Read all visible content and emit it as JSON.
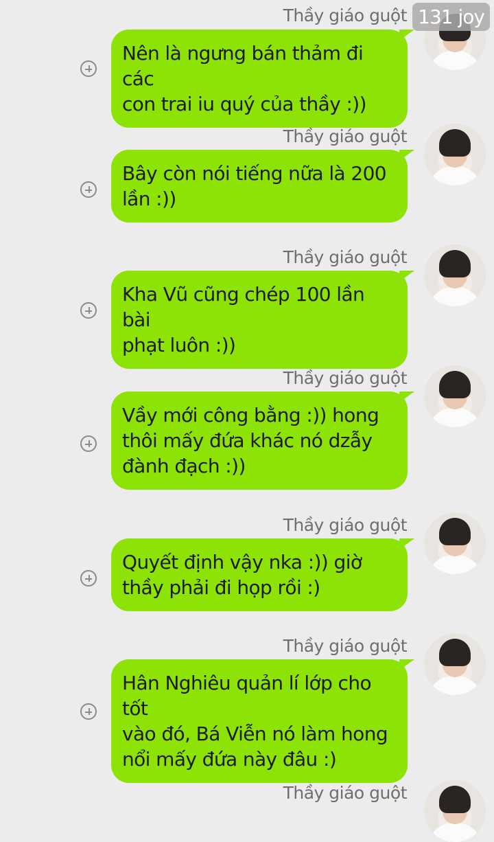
{
  "watermark": "131 joy",
  "messages": [
    {
      "sender": "Thầy giáo guột",
      "lines": [
        "Nên là ngưng bán thảm đi các",
        "con trai iu quý của thầy :))"
      ]
    },
    {
      "sender": "Thầy giáo guột",
      "lines": [
        "Bây còn nói tiếng nữa là 200",
        "lần :))"
      ]
    },
    {
      "sender": "Thầy giáo guột",
      "lines": [
        "Kha Vũ cũng chép 100 lần bài",
        "phạt luôn :))"
      ]
    },
    {
      "sender": "Thầy giáo guột",
      "lines": [
        "Vầy mới công bằng :)) hong",
        "thôi mấy đứa khác nó dzẫy",
        "đành đạch :))"
      ]
    },
    {
      "sender": "Thầy giáo guột",
      "lines": [
        "Quyết định vậy nka :)) giờ",
        "thầy phải đi họp rồi :)"
      ]
    },
    {
      "sender": "Thầy giáo guột",
      "lines": [
        "Hân Nghiêu quản lí lớp cho tốt",
        "vào đó, Bá Viễn nó làm hong",
        "nổi mấy đứa này đâu :)"
      ]
    },
    {
      "sender": "Thầy giáo guột",
      "lines": []
    }
  ],
  "icons": {
    "add": "plus-circle-icon",
    "avatar": "user-avatar"
  },
  "colors": {
    "bubble": "#8ee306",
    "background": "#ececec",
    "sender_text": "#6f6f6f"
  }
}
